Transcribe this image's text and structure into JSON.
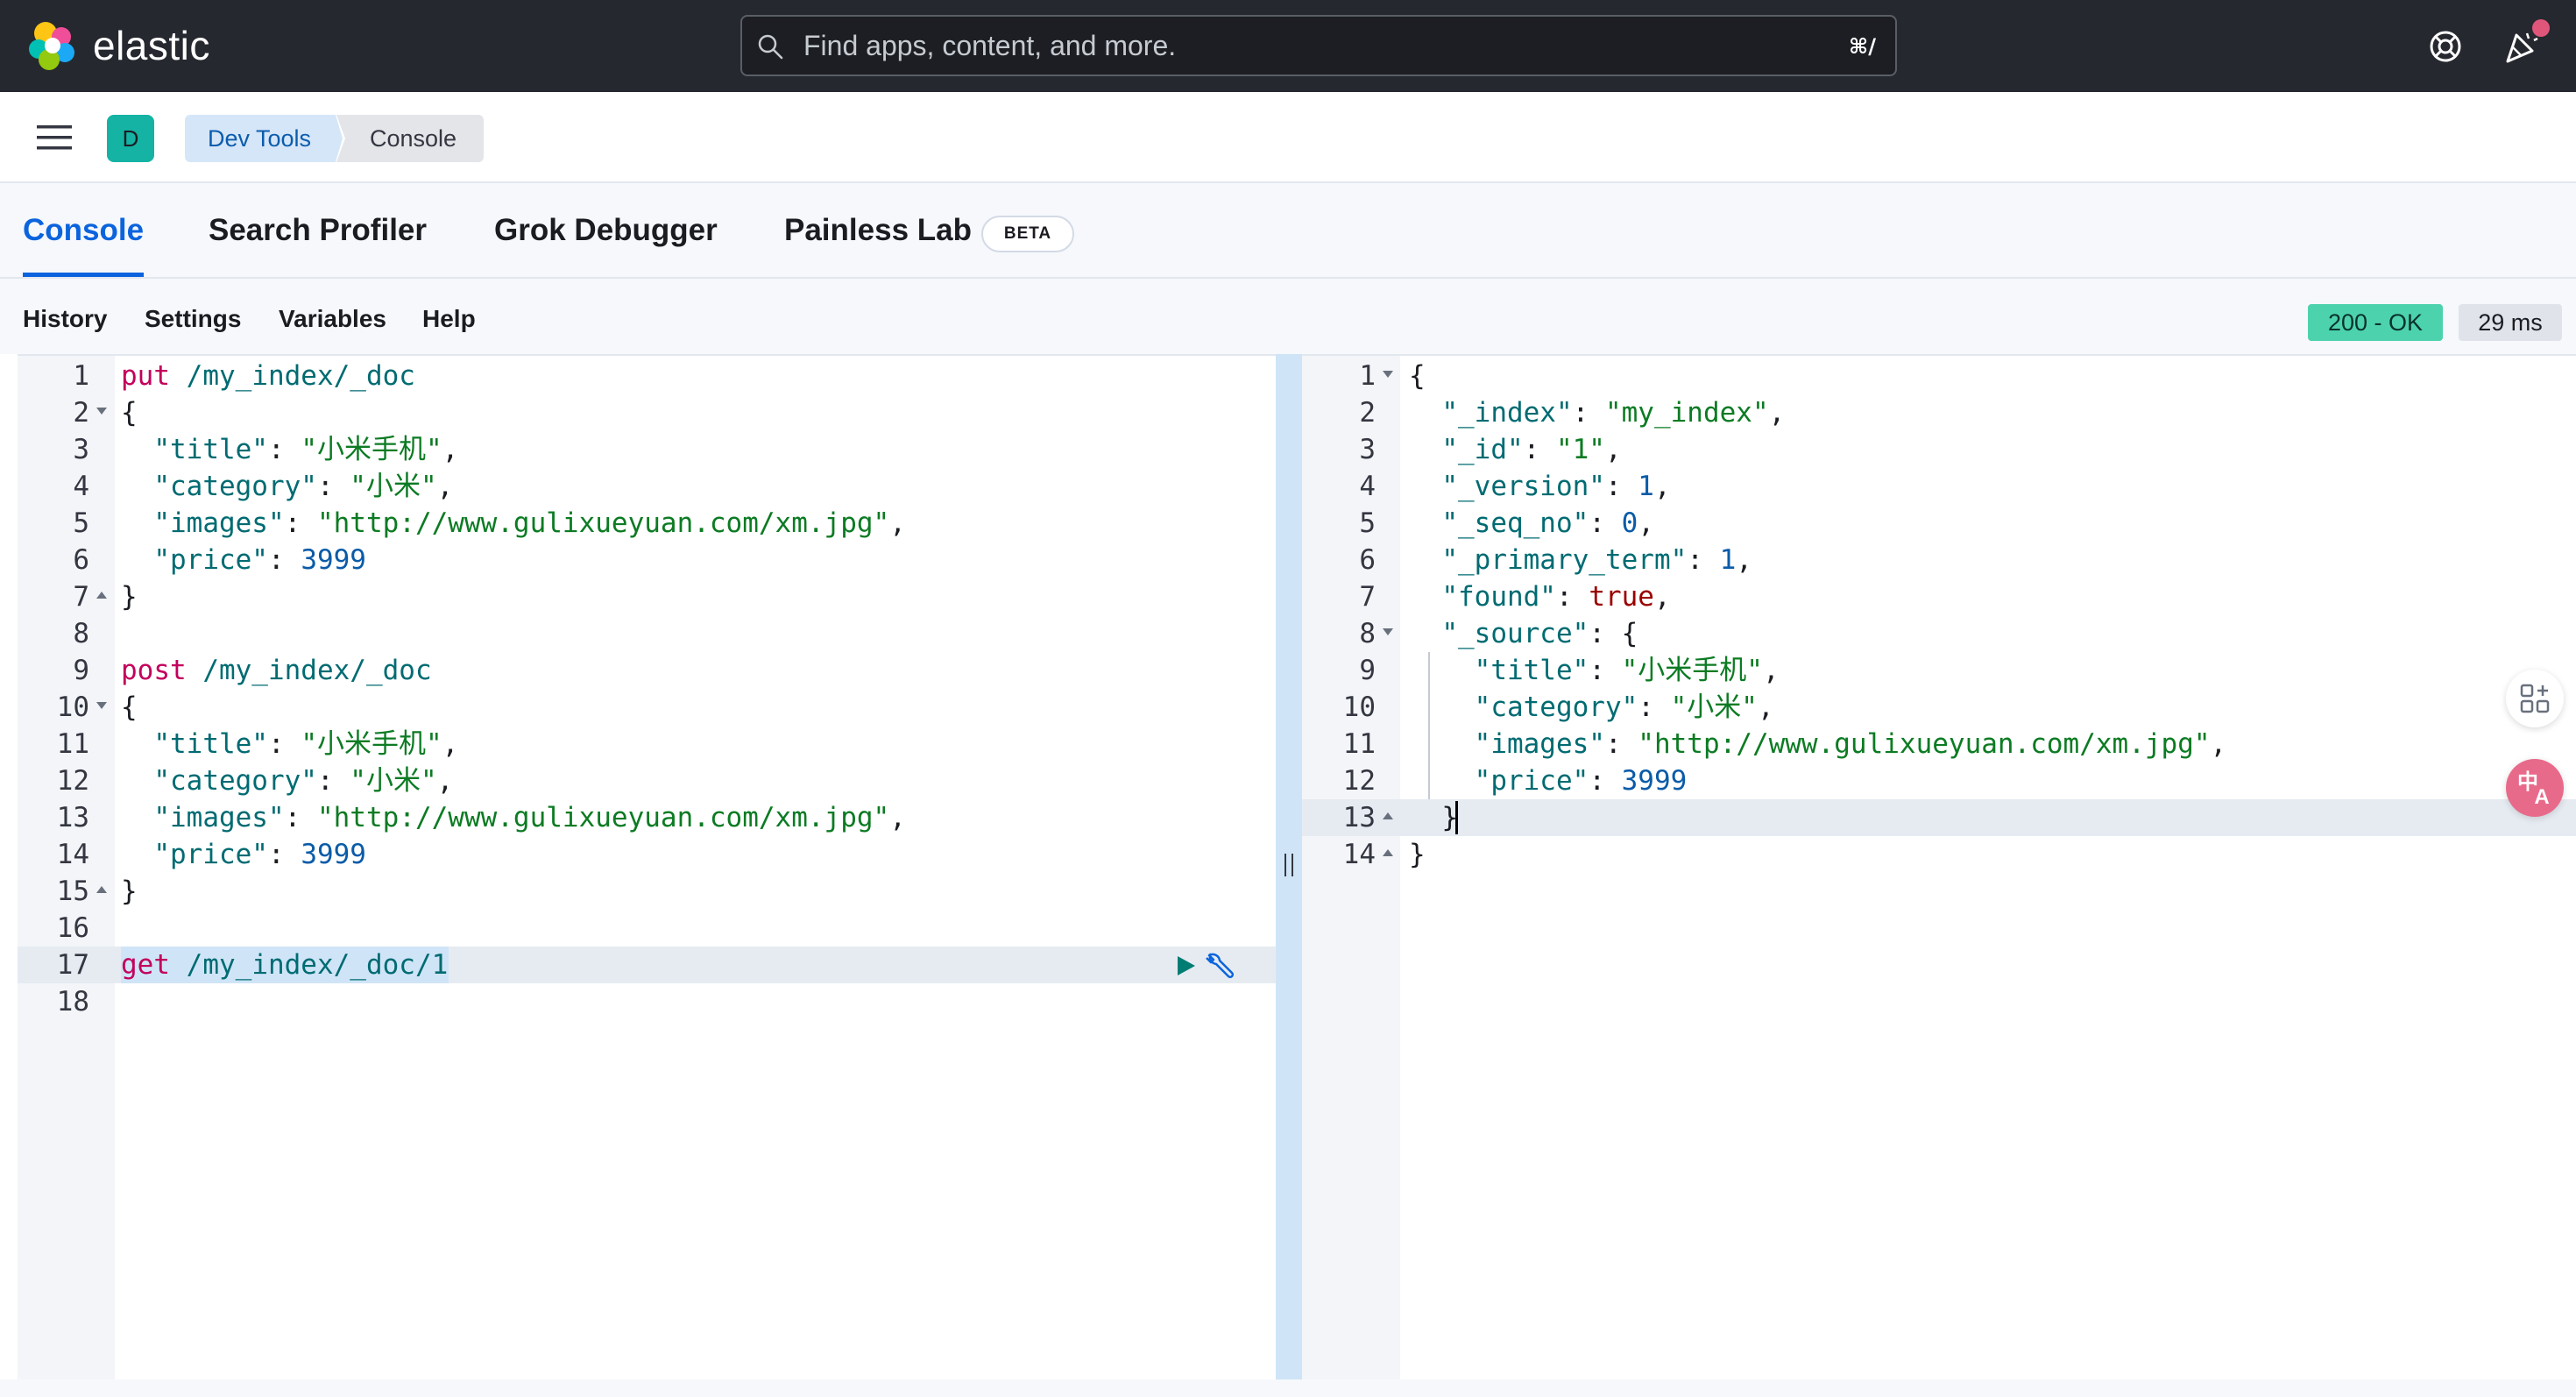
{
  "header": {
    "brand": "elastic",
    "search_placeholder": "Find apps, content, and more.",
    "search_shortcut": "⌘/",
    "logo_colors": [
      "#f04e98",
      "#fec514",
      "#00bfb3",
      "#1ba9f5",
      "#93c90e",
      "#07c"
    ]
  },
  "breadcrumb": {
    "space_initial": "D",
    "items": [
      "Dev Tools",
      "Console"
    ]
  },
  "tabs": [
    {
      "label": "Console",
      "active": true
    },
    {
      "label": "Search Profiler",
      "active": false
    },
    {
      "label": "Grok Debugger",
      "active": false
    },
    {
      "label": "Painless Lab",
      "active": false,
      "badge": "BETA"
    }
  ],
  "toolbar": {
    "links": [
      "History",
      "Settings",
      "Variables",
      "Help"
    ],
    "status": "200 - OK",
    "time": "29 ms"
  },
  "request_editor": {
    "lines": [
      {
        "num": "1",
        "tokens": [
          {
            "t": "put",
            "c": "k"
          },
          {
            "t": " /my_index/_doc",
            "c": "u"
          }
        ]
      },
      {
        "num": "2",
        "fold": "down",
        "tokens": [
          {
            "t": "{",
            "c": "p"
          }
        ]
      },
      {
        "num": "3",
        "tokens": [
          {
            "t": "  \"title\"",
            "c": "u"
          },
          {
            "t": ": ",
            "c": "p"
          },
          {
            "t": "\"小米手机\"",
            "c": "s"
          },
          {
            "t": ",",
            "c": "p"
          }
        ]
      },
      {
        "num": "4",
        "tokens": [
          {
            "t": "  \"category\"",
            "c": "u"
          },
          {
            "t": ": ",
            "c": "p"
          },
          {
            "t": "\"小米\"",
            "c": "s"
          },
          {
            "t": ",",
            "c": "p"
          }
        ]
      },
      {
        "num": "5",
        "tokens": [
          {
            "t": "  \"images\"",
            "c": "u"
          },
          {
            "t": ": ",
            "c": "p"
          },
          {
            "t": "\"http://www.gulixueyuan.com/xm.jpg\"",
            "c": "s"
          },
          {
            "t": ",",
            "c": "p"
          }
        ]
      },
      {
        "num": "6",
        "tokens": [
          {
            "t": "  \"price\"",
            "c": "u"
          },
          {
            "t": ": ",
            "c": "p"
          },
          {
            "t": "3999",
            "c": "n"
          }
        ]
      },
      {
        "num": "7",
        "fold": "up",
        "tokens": [
          {
            "t": "}",
            "c": "p"
          }
        ]
      },
      {
        "num": "8",
        "tokens": []
      },
      {
        "num": "9",
        "tokens": [
          {
            "t": "post",
            "c": "k"
          },
          {
            "t": " /my_index/_doc",
            "c": "u"
          }
        ]
      },
      {
        "num": "10",
        "fold": "down",
        "tokens": [
          {
            "t": "{",
            "c": "p"
          }
        ]
      },
      {
        "num": "11",
        "tokens": [
          {
            "t": "  \"title\"",
            "c": "u"
          },
          {
            "t": ": ",
            "c": "p"
          },
          {
            "t": "\"小米手机\"",
            "c": "s"
          },
          {
            "t": ",",
            "c": "p"
          }
        ]
      },
      {
        "num": "12",
        "tokens": [
          {
            "t": "  \"category\"",
            "c": "u"
          },
          {
            "t": ": ",
            "c": "p"
          },
          {
            "t": "\"小米\"",
            "c": "s"
          },
          {
            "t": ",",
            "c": "p"
          }
        ]
      },
      {
        "num": "13",
        "tokens": [
          {
            "t": "  \"images\"",
            "c": "u"
          },
          {
            "t": ": ",
            "c": "p"
          },
          {
            "t": "\"http://www.gulixueyuan.com/xm.jpg\"",
            "c": "s"
          },
          {
            "t": ",",
            "c": "p"
          }
        ]
      },
      {
        "num": "14",
        "tokens": [
          {
            "t": "  \"price\"",
            "c": "u"
          },
          {
            "t": ": ",
            "c": "p"
          },
          {
            "t": "3999",
            "c": "n"
          }
        ]
      },
      {
        "num": "15",
        "fold": "up",
        "tokens": [
          {
            "t": "}",
            "c": "p"
          }
        ]
      },
      {
        "num": "16",
        "tokens": []
      },
      {
        "num": "17",
        "active": true,
        "tokens": [
          {
            "t": "get",
            "c": "k"
          },
          {
            "t": " /my_index/_doc/1",
            "c": "u"
          }
        ]
      },
      {
        "num": "18",
        "tokens": []
      }
    ]
  },
  "response_editor": {
    "lines": [
      {
        "num": "1",
        "fold": "down",
        "tokens": [
          {
            "t": "{",
            "c": "p"
          }
        ]
      },
      {
        "num": "2",
        "tokens": [
          {
            "t": "  \"_index\"",
            "c": "u"
          },
          {
            "t": ": ",
            "c": "p"
          },
          {
            "t": "\"my_index\"",
            "c": "s"
          },
          {
            "t": ",",
            "c": "p"
          }
        ]
      },
      {
        "num": "3",
        "tokens": [
          {
            "t": "  \"_id\"",
            "c": "u"
          },
          {
            "t": ": ",
            "c": "p"
          },
          {
            "t": "\"1\"",
            "c": "s"
          },
          {
            "t": ",",
            "c": "p"
          }
        ]
      },
      {
        "num": "4",
        "tokens": [
          {
            "t": "  \"_version\"",
            "c": "u"
          },
          {
            "t": ": ",
            "c": "p"
          },
          {
            "t": "1",
            "c": "n"
          },
          {
            "t": ",",
            "c": "p"
          }
        ]
      },
      {
        "num": "5",
        "tokens": [
          {
            "t": "  \"_seq_no\"",
            "c": "u"
          },
          {
            "t": ": ",
            "c": "p"
          },
          {
            "t": "0",
            "c": "n"
          },
          {
            "t": ",",
            "c": "p"
          }
        ]
      },
      {
        "num": "6",
        "tokens": [
          {
            "t": "  \"_primary_term\"",
            "c": "u"
          },
          {
            "t": ": ",
            "c": "p"
          },
          {
            "t": "1",
            "c": "n"
          },
          {
            "t": ",",
            "c": "p"
          }
        ]
      },
      {
        "num": "7",
        "tokens": [
          {
            "t": "  \"found\"",
            "c": "u"
          },
          {
            "t": ": ",
            "c": "p"
          },
          {
            "t": "true",
            "c": "b"
          },
          {
            "t": ",",
            "c": "p"
          }
        ]
      },
      {
        "num": "8",
        "fold": "down",
        "tokens": [
          {
            "t": "  \"_source\"",
            "c": "u"
          },
          {
            "t": ": {",
            "c": "p"
          }
        ]
      },
      {
        "num": "9",
        "guide": true,
        "tokens": [
          {
            "t": "    \"title\"",
            "c": "u"
          },
          {
            "t": ": ",
            "c": "p"
          },
          {
            "t": "\"小米手机\"",
            "c": "s"
          },
          {
            "t": ",",
            "c": "p"
          }
        ]
      },
      {
        "num": "10",
        "guide": true,
        "tokens": [
          {
            "t": "    \"category\"",
            "c": "u"
          },
          {
            "t": ": ",
            "c": "p"
          },
          {
            "t": "\"小米\"",
            "c": "s"
          },
          {
            "t": ",",
            "c": "p"
          }
        ]
      },
      {
        "num": "11",
        "guide": true,
        "tokens": [
          {
            "t": "    \"images\"",
            "c": "u"
          },
          {
            "t": ": ",
            "c": "p"
          },
          {
            "t": "\"http://www.gulixueyuan.com/xm.jpg\"",
            "c": "s"
          },
          {
            "t": ",",
            "c": "p"
          }
        ]
      },
      {
        "num": "12",
        "guide": true,
        "tokens": [
          {
            "t": "    \"price\"",
            "c": "u"
          },
          {
            "t": ": ",
            "c": "p"
          },
          {
            "t": "3999",
            "c": "n"
          }
        ]
      },
      {
        "num": "13",
        "fold": "up",
        "active": true,
        "cursor": true,
        "tokens": [
          {
            "t": "  }",
            "c": "p"
          }
        ]
      },
      {
        "num": "14",
        "fold": "up",
        "tokens": [
          {
            "t": "}",
            "c": "p"
          }
        ]
      }
    ]
  },
  "floating": {
    "translate_label_top": "中",
    "translate_label_bottom": "A"
  }
}
